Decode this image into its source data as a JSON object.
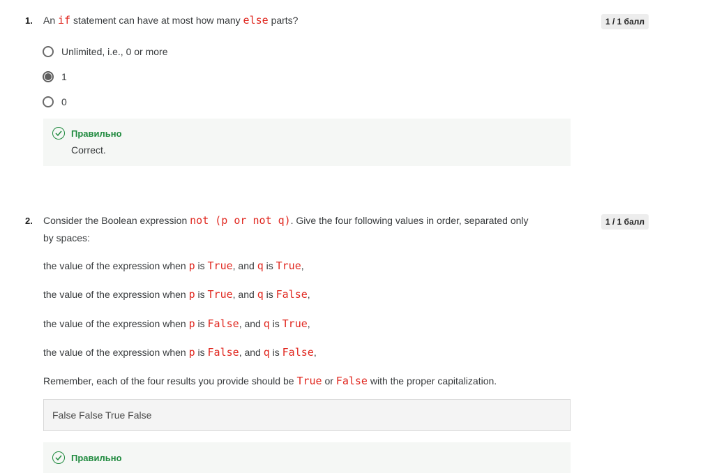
{
  "q1": {
    "number": "1.",
    "text_1": "An",
    "code_if": "if",
    "text_2": "statement can have at most how many",
    "code_else": "else",
    "text_3": "parts?",
    "score": "1 / 1 балл",
    "options": [
      {
        "label": "Unlimited, i.e., 0 or more",
        "selected": false
      },
      {
        "label": "1",
        "selected": true
      },
      {
        "label": "0",
        "selected": false
      }
    ],
    "feedback": {
      "title": "Правильно",
      "text": "Correct."
    }
  },
  "q2": {
    "number": "2.",
    "prompt_1": "Consider the Boolean expression",
    "expr": "not (p or not q)",
    "prompt_2": ". Give the four following values in order, separated only",
    "prompt_3": "by spaces:",
    "score": "1 / 1 балл",
    "lines": [
      {
        "pre": "the value of the expression when",
        "p": "p",
        "is1": "is",
        "pv": "True",
        "mid": ", and",
        "q": "q",
        "is2": "is",
        "qv": "True",
        "end": ","
      },
      {
        "pre": "the value of the expression when",
        "p": "p",
        "is1": "is",
        "pv": "True",
        "mid": ", and",
        "q": "q",
        "is2": "is",
        "qv": "False",
        "end": ","
      },
      {
        "pre": "the value of the expression when",
        "p": "p",
        "is1": "is",
        "pv": "False",
        "mid": ", and",
        "q": "q",
        "is2": "is",
        "qv": "True",
        "end": ","
      },
      {
        "pre": "the value of the expression when",
        "p": "p",
        "is1": "is",
        "pv": "False",
        "mid": ", and",
        "q": "q",
        "is2": "is",
        "qv": "False",
        "end": ","
      }
    ],
    "remember_1": "Remember, each of the four results you provide should be",
    "remember_true": "True",
    "remember_or": "or",
    "remember_false": "False",
    "remember_2": "with the proper capitalization.",
    "answer": "False False True False",
    "feedback": {
      "title": "Правильно"
    }
  },
  "colors": {
    "code": "#e0271f",
    "correct": "#1f8a3e",
    "feedback_bg": "#f5f7f5"
  }
}
